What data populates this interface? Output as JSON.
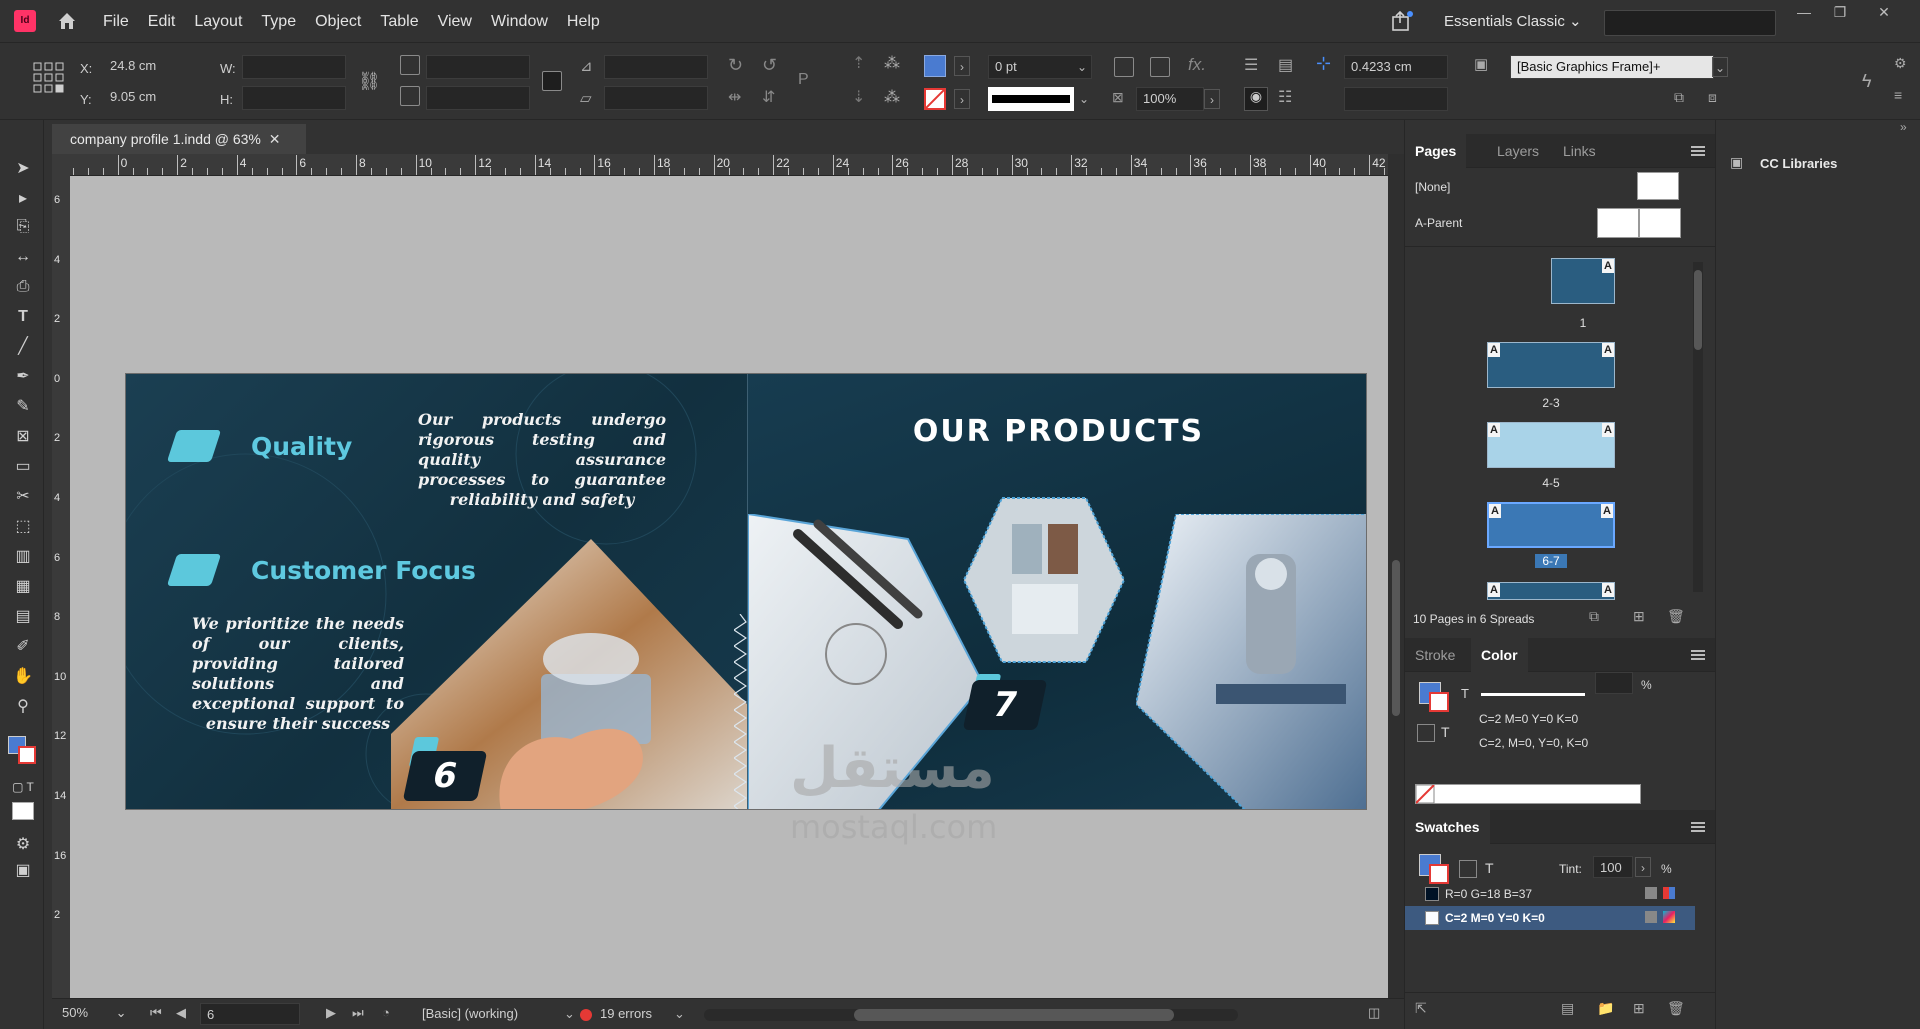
{
  "app": {
    "logo_text": "Id",
    "menus": [
      "File",
      "Edit",
      "Layout",
      "Type",
      "Object",
      "Table",
      "View",
      "Window",
      "Help"
    ],
    "workspace": "Essentials Classic"
  },
  "control": {
    "x_label": "X:",
    "x_value": "24.8 cm",
    "y_label": "Y:",
    "y_value": "9.05 cm",
    "w_label": "W:",
    "h_label": "H:",
    "stroke_weight": "0 pt",
    "gap_value": "0.4233 cm",
    "opacity": "100%",
    "object_style": "[Basic Graphics Frame]+"
  },
  "document": {
    "tab_title": "company profile 1.indd @ 63%",
    "ruler_h": [
      "2",
      "0",
      "2",
      "4",
      "6",
      "8",
      "10",
      "12",
      "14",
      "16",
      "18",
      "20",
      "22",
      "24",
      "26",
      "28",
      "30",
      "32",
      "34",
      "36",
      "38",
      "40",
      "42"
    ],
    "ruler_v": [
      "6",
      "4",
      "2",
      "0",
      "2",
      "4",
      "6",
      "8",
      "10",
      "12",
      "14",
      "16",
      "2"
    ]
  },
  "spread": {
    "left": {
      "heading1": "Quality",
      "heading2": "Customer Focus",
      "paragraph1": "Our products undergo rigorous testing and quality assurance processes to guarantee reliability and safety",
      "paragraph2": "We prioritize the needs of our clients, providing tailored solutions and exceptional support to ensure their success",
      "page_number": "6"
    },
    "right": {
      "title": "OUR PRODUCTS",
      "page_number": "7"
    }
  },
  "status": {
    "zoom": "50%",
    "page": "6",
    "profile": "[Basic] (working)",
    "errors": "19 errors"
  },
  "pages_panel": {
    "tabs": [
      "Pages",
      "Layers",
      "Links"
    ],
    "none_label": "[None]",
    "parent_label": "A-Parent",
    "spreads": [
      "1",
      "2-3",
      "4-5",
      "6-7"
    ],
    "footer": "10 Pages in 6 Spreads"
  },
  "color_panel": {
    "tabs": [
      "Stroke",
      "Color"
    ],
    "t_label": "T",
    "percent": "%",
    "line1": "C=2 M=0 Y=0 K=0",
    "line2": "C=2, M=0, Y=0, K=0"
  },
  "swatches_panel": {
    "title": "Swatches",
    "tint_label": "Tint:",
    "tint_value": "100",
    "percent": "%",
    "items": [
      "R=0 G=18 B=37",
      "C=2 M=0 Y=0 K=0"
    ]
  },
  "cc_libraries": {
    "title": "CC Libraries"
  },
  "watermark": {
    "line1": "مستقل",
    "line2": "mostaql.com"
  },
  "colors": {
    "accent_blue": "#4a7bd0",
    "cyan": "#5ec9e0",
    "navy": "#17384b",
    "error_red": "#e53935"
  }
}
